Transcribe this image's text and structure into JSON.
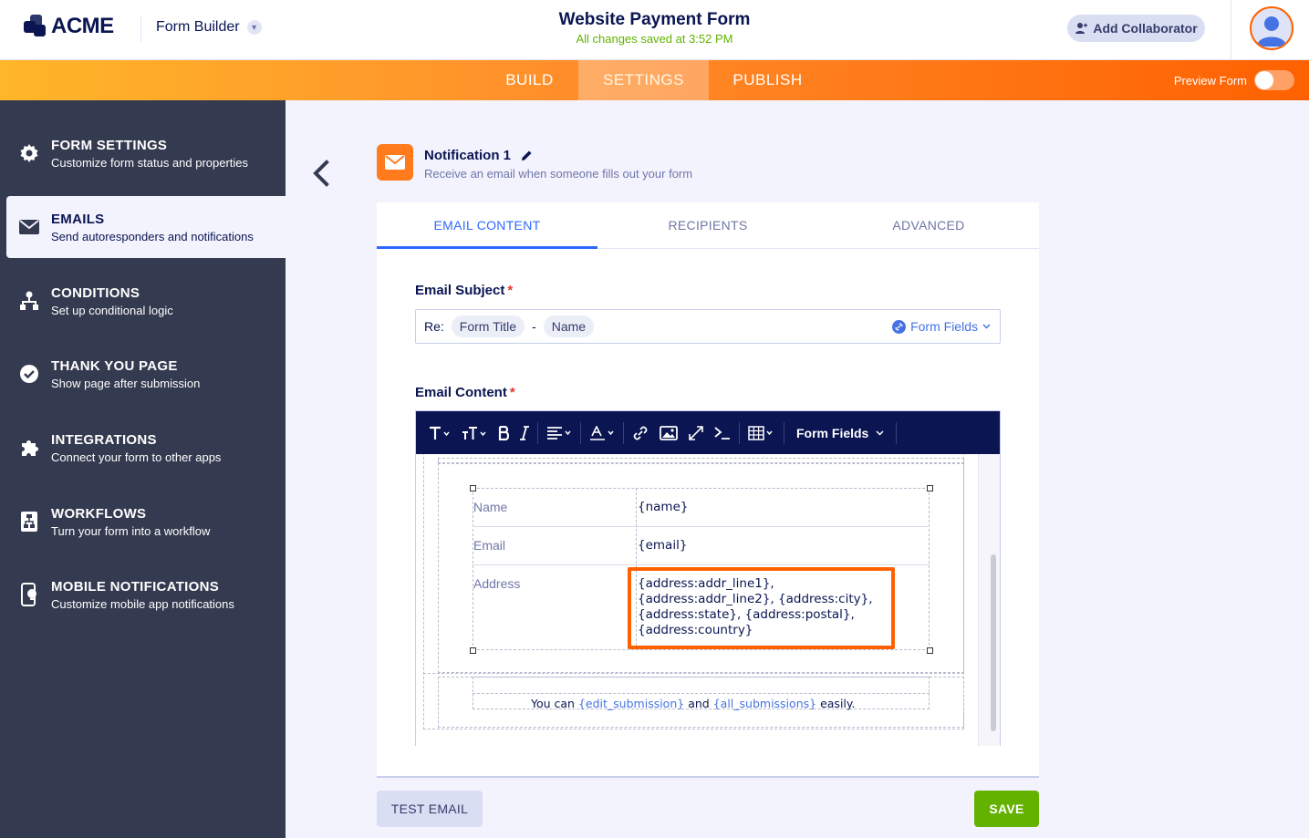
{
  "header": {
    "logo_text": "ACME",
    "builder_label": "Form Builder",
    "form_title": "Website Payment Form",
    "save_status": "All changes saved at 3:52 PM",
    "collaborator_label": "Add Collaborator"
  },
  "nav": {
    "tabs": [
      {
        "label": "BUILD"
      },
      {
        "label": "SETTINGS"
      },
      {
        "label": "PUBLISH"
      }
    ],
    "active_tab": "SETTINGS",
    "preview_label": "Preview Form"
  },
  "sidebar": {
    "items": [
      {
        "title": "FORM SETTINGS",
        "subtitle": "Customize form status and properties",
        "icon": "gear-icon"
      },
      {
        "title": "EMAILS",
        "subtitle": "Send autoresponders and notifications",
        "icon": "envelope-icon"
      },
      {
        "title": "CONDITIONS",
        "subtitle": "Set up conditional logic",
        "icon": "hierarchy-icon"
      },
      {
        "title": "THANK YOU PAGE",
        "subtitle": "Show page after submission",
        "icon": "check-circle-icon"
      },
      {
        "title": "INTEGRATIONS",
        "subtitle": "Connect your form to other apps",
        "icon": "puzzle-icon"
      },
      {
        "title": "WORKFLOWS",
        "subtitle": "Turn your form into a workflow",
        "icon": "workflow-icon"
      },
      {
        "title": "MOBILE NOTIFICATIONS",
        "subtitle": "Customize mobile app notifications",
        "icon": "mobile-bell-icon"
      }
    ],
    "active_item": "EMAILS"
  },
  "notification": {
    "title": "Notification 1",
    "subtitle": "Receive an email when someone fills out your form"
  },
  "tabs": [
    {
      "label": "EMAIL CONTENT"
    },
    {
      "label": "RECIPIENTS"
    },
    {
      "label": "ADVANCED"
    }
  ],
  "subject": {
    "label": "Email Subject",
    "required_mark": "*",
    "prefix": "Re:",
    "chip1": "Form Title",
    "separator": "-",
    "chip2": "Name",
    "form_fields_label": "Form Fields"
  },
  "content": {
    "label": "Email Content",
    "required_mark": "*",
    "toolbar_form_fields": "Form Fields",
    "rows": [
      {
        "label": "Name",
        "value": "{name}"
      },
      {
        "label": "Email",
        "value": "{email}"
      },
      {
        "label": "Address",
        "value_lines": [
          "{address:addr_line1},",
          "{address:addr_line2}, {address:city},",
          "{address:state}, {address:postal},",
          "{address:country}"
        ]
      }
    ],
    "footer": {
      "prefix": "You can",
      "tag1": "{edit_submission}",
      "middle": "and",
      "tag2": "{all_submissions}",
      "suffix": "easily."
    }
  },
  "actions": {
    "test_email": "TEST EMAIL",
    "save": "SAVE"
  },
  "colors": {
    "accent_orange": "#ff6100",
    "nav_gradient_start": "#ffb629",
    "sidebar_bg": "#343a4f",
    "link_blue": "#2e69ff",
    "save_green": "#64b200"
  }
}
